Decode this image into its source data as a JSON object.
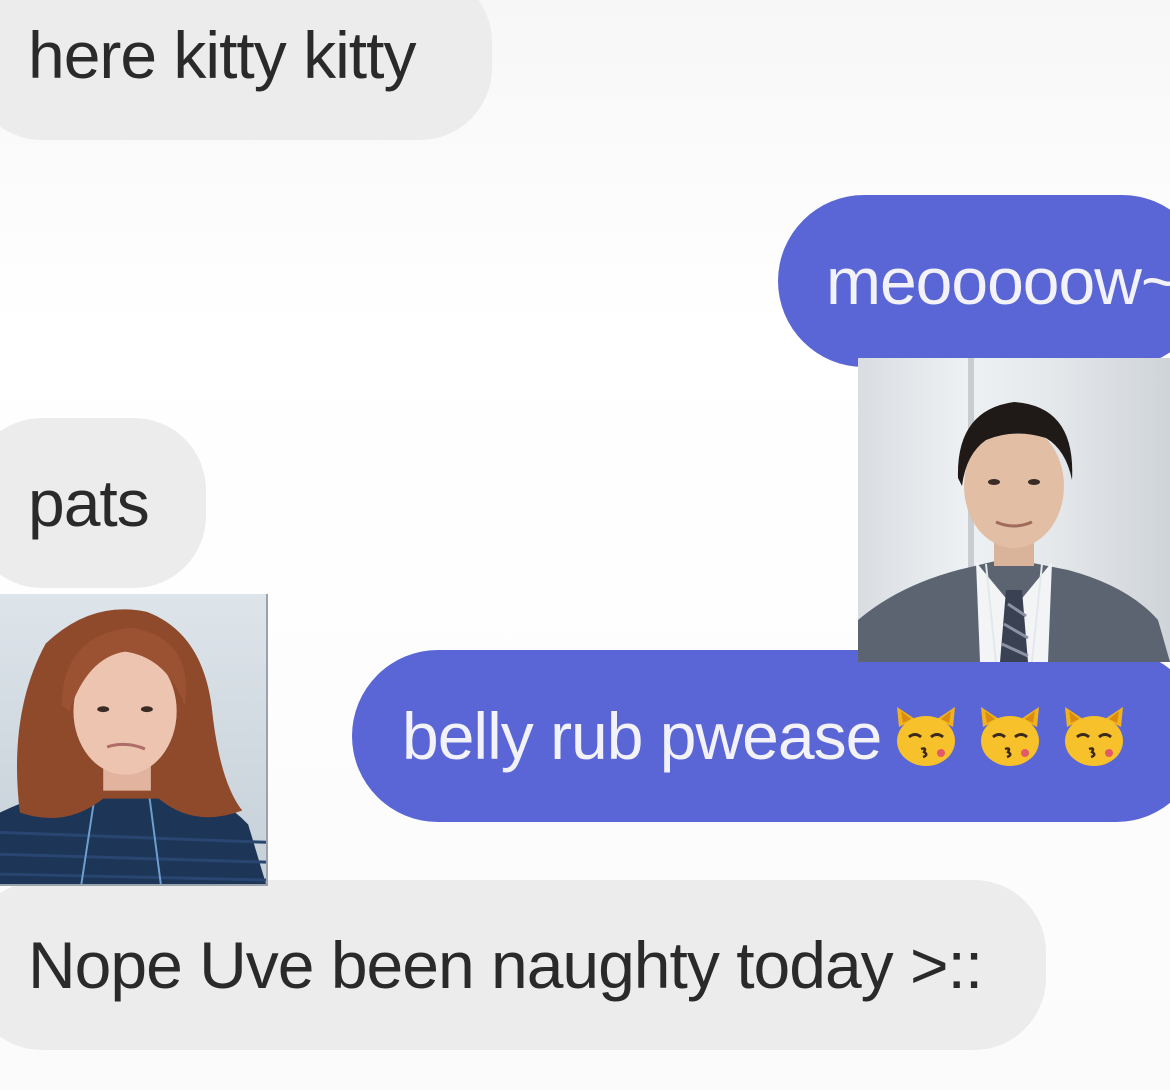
{
  "messages": [
    {
      "id": "m1",
      "direction": "incoming",
      "text": "here kitty kitty"
    },
    {
      "id": "m2",
      "direction": "outgoing",
      "text": "meooooow~"
    },
    {
      "id": "m3",
      "direction": "incoming",
      "text": "pats"
    },
    {
      "id": "m4",
      "direction": "outgoing",
      "text": "belly rub pwease",
      "emoji": [
        "kissing-cat-icon",
        "kissing-cat-icon",
        "kissing-cat-icon"
      ]
    },
    {
      "id": "m5",
      "direction": "incoming",
      "text": "Nope Uve been naughty today >::"
    }
  ],
  "photos": [
    {
      "name": "man-in-suit-photo",
      "description_icon": "portrait"
    },
    {
      "name": "woman-with-auburn-hair-photo",
      "description_icon": "portrait"
    }
  ],
  "colors": {
    "outgoing_bubble": "#5a66d6",
    "incoming_bubble": "#ececec",
    "incoming_text": "#2a2a2a",
    "outgoing_text": "#f2f2f8",
    "background": "#ffffff"
  }
}
